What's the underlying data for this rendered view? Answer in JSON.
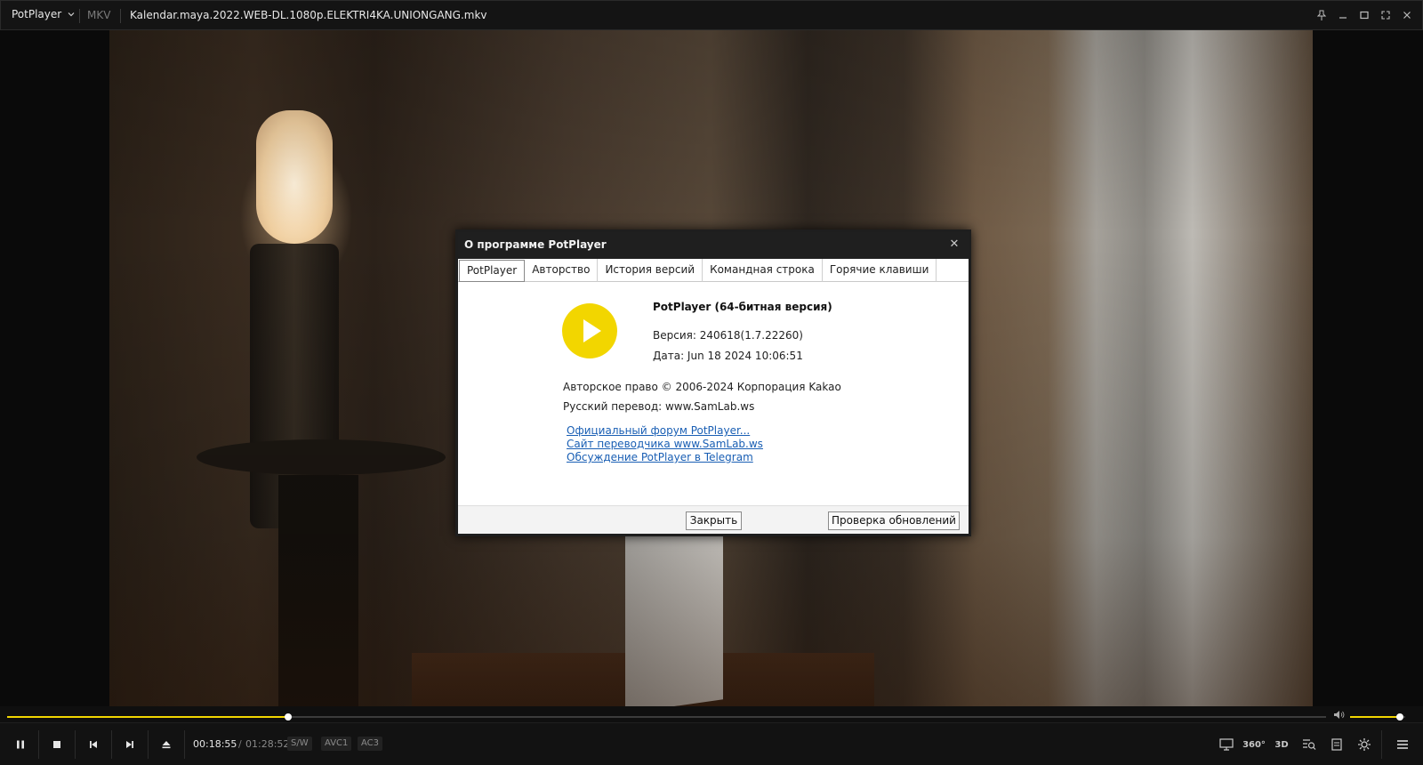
{
  "titlebar": {
    "app_name": "PotPlayer",
    "format": "MKV",
    "filename": "Kalendar.maya.2022.WEB-DL.1080p.ELEKTRI4KA.UNIONGANG.mkv",
    "controls": [
      "pin-icon",
      "minimize-icon",
      "maximize-icon",
      "fullscreen-icon",
      "close-icon"
    ]
  },
  "dialog": {
    "title": "О программе PotPlayer",
    "tabs": [
      {
        "label": "PotPlayer",
        "active": true
      },
      {
        "label": "Авторство",
        "active": false
      },
      {
        "label": "История версий",
        "active": false
      },
      {
        "label": "Командная строка",
        "active": false
      },
      {
        "label": "Горячие клавиши",
        "active": false
      }
    ],
    "product_name": "PotPlayer (64-битная версия)",
    "version": "Версия: 240618(1.7.22260)",
    "date": "Дата: Jun 18 2024 10:06:51",
    "copyright": "Авторское право © 2006-2024 Корпорация Kakao",
    "translation": "Русский перевод: www.SamLab.ws",
    "links": [
      "Официальный форум PotPlayer...",
      "Сайт переводчика www.SamLab.ws",
      "Обсуждение PotPlayer в Telegram"
    ],
    "close_button": "Закрыть",
    "update_button": "Проверка обновлений",
    "logo_color": "#f2d600"
  },
  "playback": {
    "current_time": "00:18:55",
    "separator": "/",
    "total_time": "01:28:52",
    "progress_fraction": 0.213,
    "volume_fraction": 0.9,
    "tags": [
      "S/W",
      "AVC1",
      "AC3"
    ],
    "accent_color": "#f2d600"
  },
  "controls_right": [
    "cast-icon",
    "360-icon",
    "3d-icon",
    "playlist-search-icon",
    "chapter-icon",
    "settings-icon",
    "menu-icon"
  ],
  "controls_right_labels": {
    "vr": "360°",
    "threed": "3D"
  }
}
